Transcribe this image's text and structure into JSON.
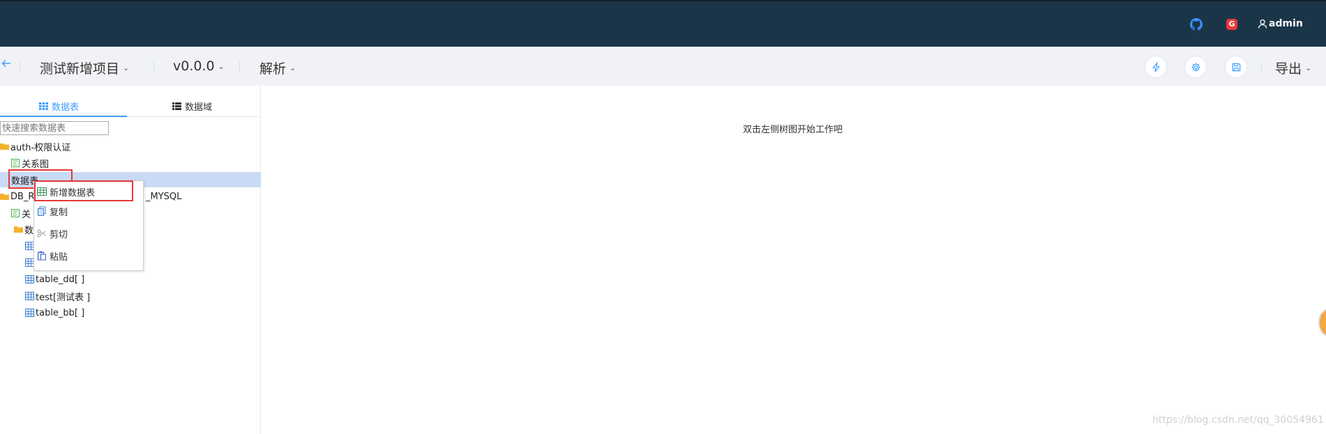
{
  "header": {
    "user_name": "admin",
    "g_badge": "G"
  },
  "toolbar": {
    "project_name": "测试新增项目",
    "version": "v0.0.0",
    "parse_label": "解析",
    "export_label": "导出"
  },
  "left_panel": {
    "tabs": [
      {
        "label": "数据表"
      },
      {
        "label": "数据域"
      }
    ],
    "search_placeholder": "快速搜索数据表",
    "tree": [
      {
        "label": "auth-权限认证",
        "icon": "folder-icon"
      },
      {
        "label": "关系图",
        "icon": "diagram-icon"
      },
      {
        "label": "数据表",
        "icon": "none"
      },
      {
        "label": "DB_R",
        "icon": "folder-icon"
      },
      {
        "label": "_MYSQL",
        "icon": "none"
      },
      {
        "label": "关",
        "icon": "diagram-icon"
      },
      {
        "label": "数",
        "icon": "folder-icon"
      },
      {
        "label": "table_dd[ ]",
        "icon": "table-icon"
      },
      {
        "label": "test[测试表 ]",
        "icon": "table-icon"
      },
      {
        "label": "table_bb[ ]",
        "icon": "table-icon"
      }
    ]
  },
  "context_menu": {
    "items": [
      {
        "label": "新增数据表",
        "icon": "table-add-icon"
      },
      {
        "label": "复制",
        "icon": "copy-icon"
      },
      {
        "label": "剪切",
        "icon": "scissors-icon"
      },
      {
        "label": "粘贴",
        "icon": "paste-icon"
      }
    ]
  },
  "main": {
    "hint": "双击左侧树图开始工作吧",
    "watermark": "https://blog.csdn.net/qq_30054961"
  },
  "colors": {
    "header_bg": "#1b3548",
    "accent": "#409eff",
    "selection": "#c9daf4",
    "highlight": "#e53935"
  }
}
